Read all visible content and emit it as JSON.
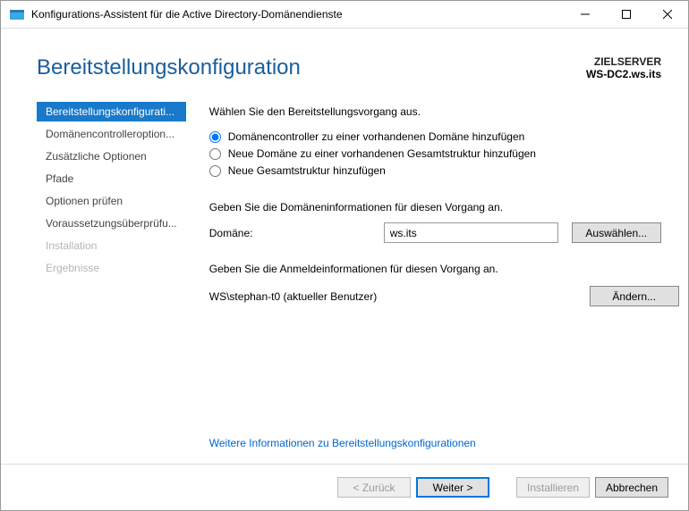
{
  "titlebar": {
    "title": "Konfigurations-Assistent für die Active Directory-Domänendienste"
  },
  "header": {
    "page_title": "Bereitstellungskonfiguration",
    "target_label": "ZIELSERVER",
    "target_value": "WS-DC2.ws.its"
  },
  "sidebar": {
    "items": [
      {
        "label": "Bereitstellungskonfigurati...",
        "state": "active"
      },
      {
        "label": "Domänencontrolleroption...",
        "state": "normal"
      },
      {
        "label": "Zusätzliche Optionen",
        "state": "normal"
      },
      {
        "label": "Pfade",
        "state": "normal"
      },
      {
        "label": "Optionen prüfen",
        "state": "normal"
      },
      {
        "label": "Voraussetzungsüberprüfu...",
        "state": "normal"
      },
      {
        "label": "Installation",
        "state": "disabled"
      },
      {
        "label": "Ergebnisse",
        "state": "disabled"
      }
    ]
  },
  "main": {
    "instruction": "Wählen Sie den Bereitstellungsvorgang aus.",
    "radios": {
      "opt1": "Domänencontroller zu einer vorhandenen Domäne hinzufügen",
      "opt2": "Neue Domäne zu einer vorhandenen Gesamtstruktur hinzufügen",
      "opt3": "Neue Gesamtstruktur hinzufügen"
    },
    "domain_section_label": "Geben Sie die Domäneninformationen für diesen Vorgang an.",
    "domain_label": "Domäne:",
    "domain_value": "ws.its",
    "select_button": "Auswählen...",
    "cred_section_label": "Geben Sie die Anmeldeinformationen für diesen Vorgang an.",
    "cred_user": "WS\\stephan-t0 (aktueller Benutzer)",
    "change_button": "Ändern...",
    "more_link": "Weitere Informationen zu Bereitstellungskonfigurationen"
  },
  "footer": {
    "back": "< Zurück",
    "next": "Weiter >",
    "install": "Installieren",
    "cancel": "Abbrechen"
  }
}
